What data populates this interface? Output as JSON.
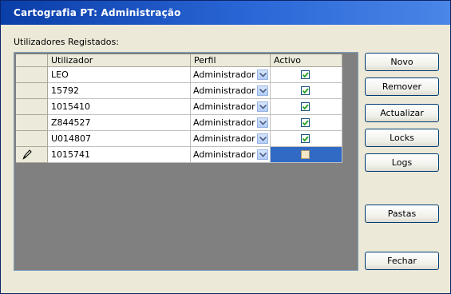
{
  "window": {
    "title": "Cartografia PT:  Administração"
  },
  "section_label": "Utilizadores Registados:",
  "grid": {
    "columns": [
      "Utilizador",
      "Perfil",
      "Activo"
    ],
    "rows": [
      {
        "user": "LEO",
        "profile": "Administrador",
        "active": true
      },
      {
        "user": "15792",
        "profile": "Administrador",
        "active": true
      },
      {
        "user": "1015410",
        "profile": "Administrador",
        "active": true
      },
      {
        "user": "Z844527",
        "profile": "Administrador",
        "active": true
      },
      {
        "user": "U014807",
        "profile": "Administrador",
        "active": true
      },
      {
        "user": "1015741",
        "profile": "Administrador",
        "active": false,
        "editing": true
      }
    ]
  },
  "buttons": {
    "novo": "Novo",
    "remover": "Remover",
    "actualizar": "Actualizar",
    "locks": "Locks",
    "logs": "Logs",
    "pastas": "Pastas",
    "fechar": "Fechar"
  },
  "colors": {
    "title_bar": "#2a66d6",
    "selection": "#316ac5",
    "grid_background": "#808080",
    "window_background": "#ece9d8"
  },
  "icons": {
    "edit_row": "pencil-icon",
    "combo": "chevron-down-icon",
    "check": "checkmark-icon"
  }
}
